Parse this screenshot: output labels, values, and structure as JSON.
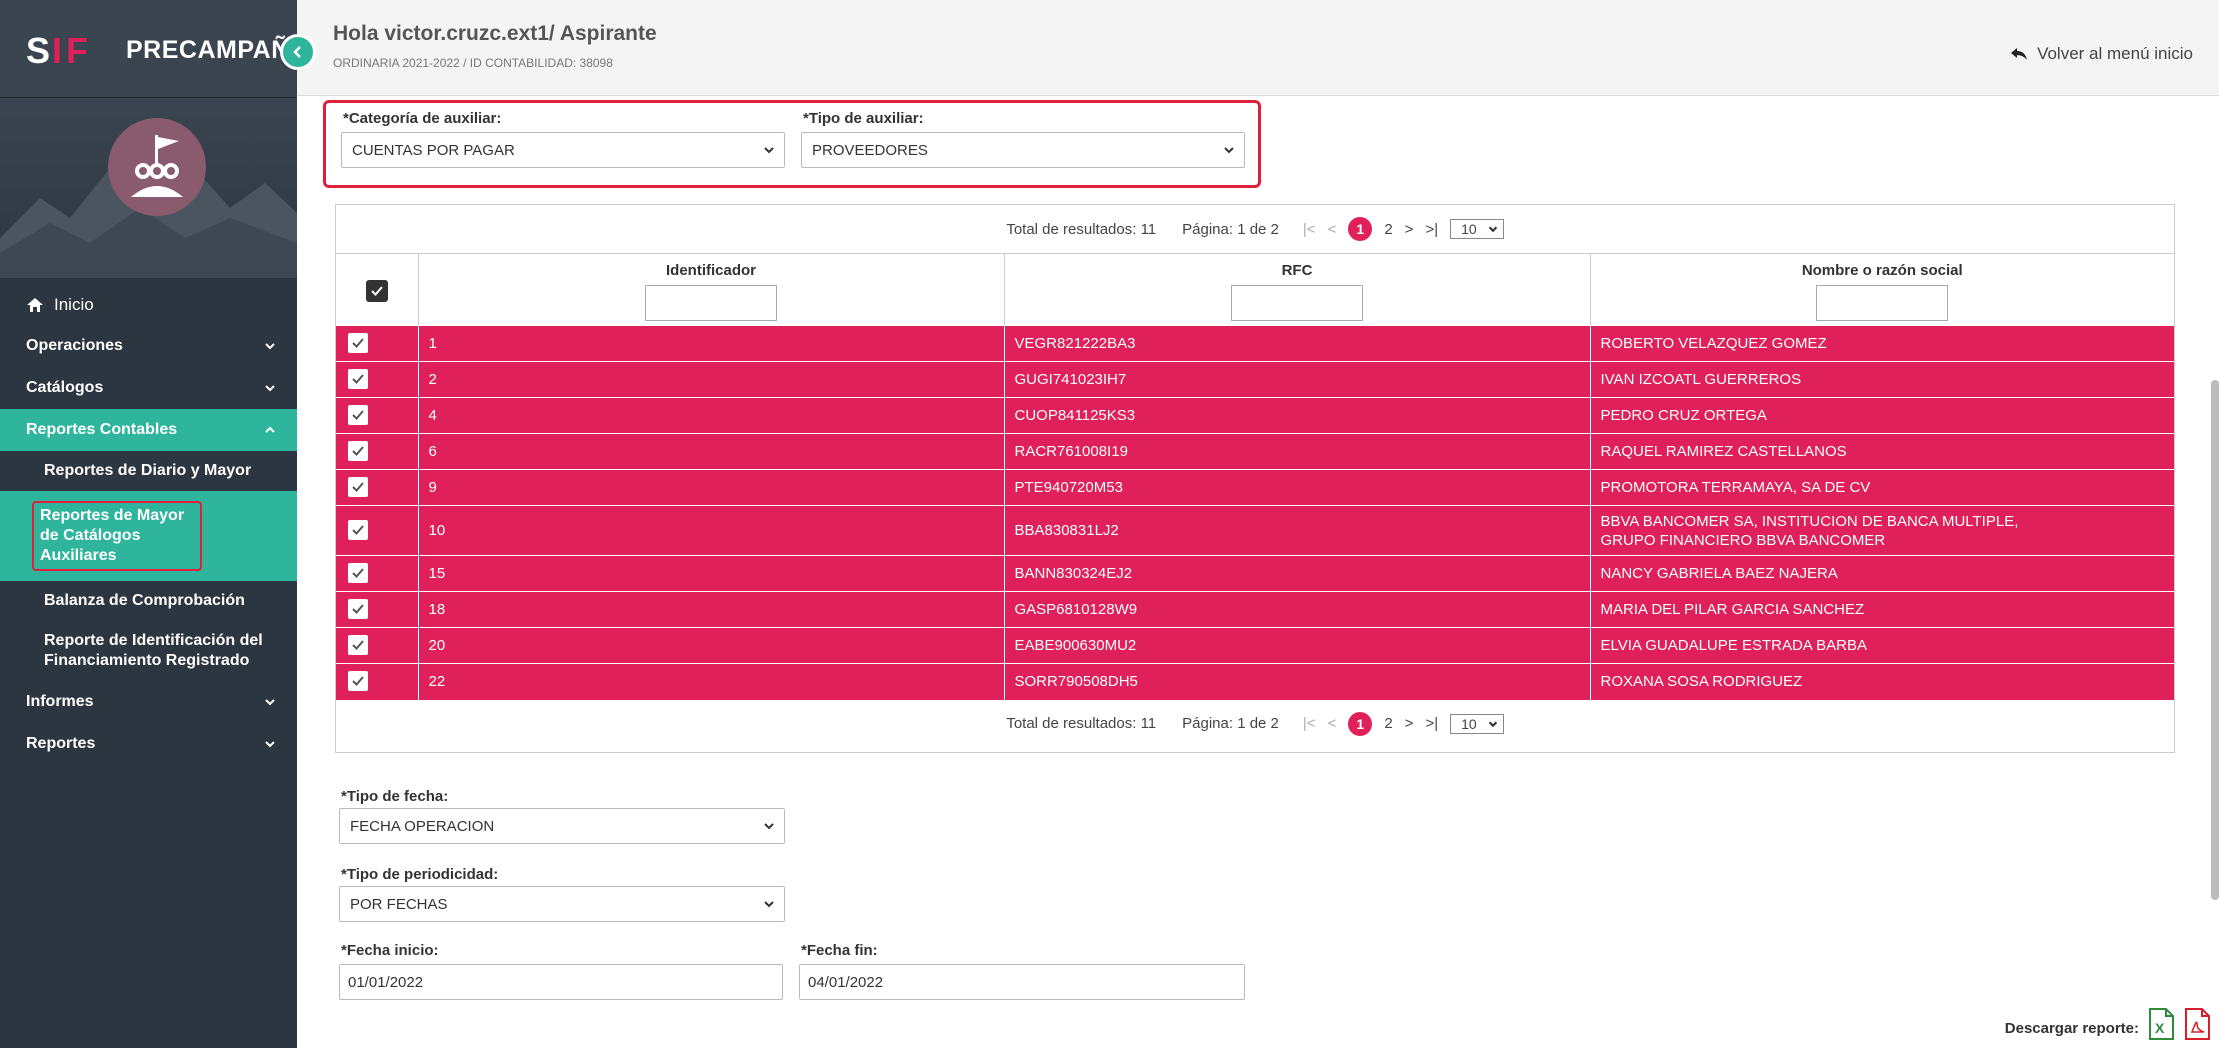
{
  "brand": {
    "title": "PRECAMPAÑA",
    "logo_text": "SIF"
  },
  "header": {
    "greeting": "Hola victor.cruzc.ext1/ Aspirante",
    "subtitle": "ORDINARIA 2021-2022 / ID CONTABILIDAD: 38098",
    "back_label": "Volver al menú inicio"
  },
  "sidebar": {
    "home": "Inicio",
    "items": [
      {
        "label": "Operaciones"
      },
      {
        "label": "Catálogos"
      },
      {
        "label": "Reportes Contables"
      }
    ],
    "subitems": [
      {
        "label": "Reportes de Diario y Mayor"
      },
      {
        "label": "Reportes de Mayor de Catálogos Auxiliares"
      },
      {
        "label": "Balanza de Comprobación"
      },
      {
        "label": "Reporte de Identificación del Financiamiento Registrado"
      }
    ],
    "items_after": [
      {
        "label": "Informes"
      },
      {
        "label": "Reportes"
      }
    ]
  },
  "filters": {
    "categoria_label": "*Categoría de auxiliar:",
    "categoria_value": "CUENTAS POR PAGAR",
    "tipo_label": "*Tipo de auxiliar:",
    "tipo_value": "PROVEEDORES"
  },
  "pager": {
    "total": "Total de resultados: 11",
    "page": "Página: 1 de 2",
    "first": "|<",
    "prev": "<",
    "p1": "1",
    "p2": "2",
    "next": ">",
    "last": ">|",
    "size": "10"
  },
  "table": {
    "columns": [
      "Identificador",
      "RFC",
      "Nombre o razón social"
    ],
    "rows": [
      [
        "1",
        "VEGR821222BA3",
        "ROBERTO VELAZQUEZ GOMEZ"
      ],
      [
        "2",
        "GUGI741023IH7",
        "IVAN IZCOATL GUERREROS"
      ],
      [
        "4",
        "CUOP841125KS3",
        "PEDRO CRUZ ORTEGA"
      ],
      [
        "6",
        "RACR761008I19",
        "RAQUEL RAMIREZ CASTELLANOS"
      ],
      [
        "9",
        "PTE940720M53",
        "PROMOTORA TERRAMAYA, SA DE CV"
      ],
      [
        "10",
        "BBA830831LJ2",
        "BBVA BANCOMER SA, INSTITUCION DE BANCA MULTIPLE, GRUPO FINANCIERO BBVA BANCOMER"
      ],
      [
        "15",
        "BANN830324EJ2",
        "NANCY GABRIELA BAEZ NAJERA"
      ],
      [
        "18",
        "GASP6810128W9",
        "MARIA DEL PILAR GARCIA SANCHEZ"
      ],
      [
        "20",
        "EABE900630MU2",
        "ELVIA GUADALUPE ESTRADA BARBA"
      ],
      [
        "22",
        "SORR790508DH5",
        "ROXANA SOSA RODRIGUEZ"
      ]
    ]
  },
  "form": {
    "tipo_fecha_label": "*Tipo de fecha:",
    "tipo_fecha_value": "FECHA OPERACION",
    "periodicidad_label": "*Tipo de periodicidad:",
    "periodicidad_value": "POR FECHAS",
    "fecha_inicio_label": "*Fecha inicio:",
    "fecha_inicio_value": "01/01/2022",
    "fecha_fin_label": "*Fecha fin:",
    "fecha_fin_value": "04/01/2022"
  },
  "download": {
    "label": "Descargar reporte:"
  },
  "colors": {
    "accent": "#2fb59c",
    "row": "#e0205a",
    "highlight": "#e0203a",
    "sidebar": "#2b3640"
  }
}
